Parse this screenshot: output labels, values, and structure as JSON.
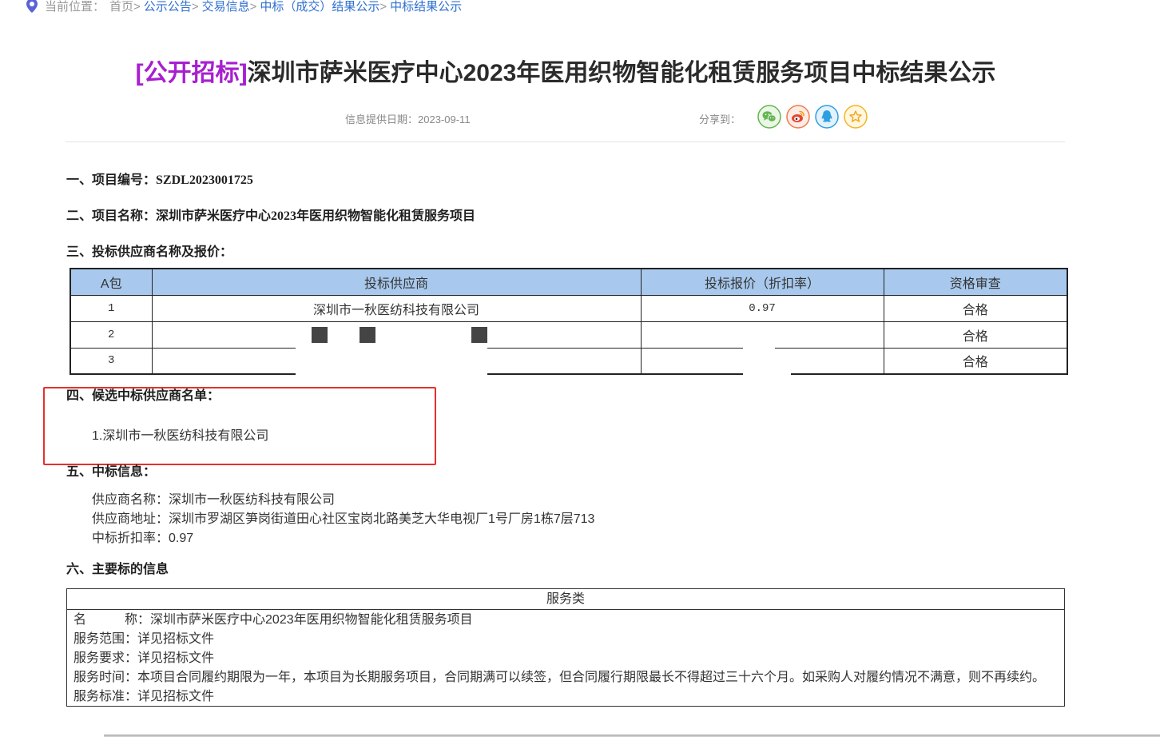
{
  "breadcrumb": {
    "prefix": "当前位置：",
    "separator": ">",
    "items": [
      {
        "label": "首页"
      },
      {
        "label": "公示公告"
      },
      {
        "label": "交易信息"
      },
      {
        "label": "中标（成交）结果公示"
      },
      {
        "label": "中标结果公示"
      }
    ]
  },
  "title": {
    "tag": "[公开招标]",
    "text": "深圳市萨米医疗中心2023年医用织物智能化租赁服务项目中标结果公示"
  },
  "meta": {
    "date_label": "信息提供日期：",
    "date": "2023-09-11",
    "share_label": "分享到：",
    "share_icons": [
      "wechat-icon",
      "weibo-icon",
      "qq-icon",
      "favorite-star-icon"
    ]
  },
  "section1": {
    "heading": "一、项目编号：",
    "value": "SZDL2023001725"
  },
  "section2": {
    "heading": "二、项目名称：",
    "value": "深圳市萨米医疗中心2023年医用织物智能化租赁服务项目"
  },
  "section3": {
    "heading": "三、投标供应商名称及报价：",
    "table": {
      "headers": [
        "A包",
        "投标供应商",
        "投标报价（折扣率）",
        "资格审查"
      ],
      "rows": [
        [
          "1",
          "深圳市一秋医纺科技有限公司",
          "0.97",
          "合格"
        ],
        [
          "2",
          "",
          "",
          "合格"
        ],
        [
          "3",
          "",
          "",
          "合格"
        ]
      ]
    }
  },
  "section4": {
    "heading": "四、候选中标供应商名单：",
    "candidates": [
      "1.深圳市一秋医纺科技有限公司"
    ]
  },
  "section5": {
    "heading": "五、中标信息：",
    "fields": [
      {
        "label": "供应商名称：",
        "value": "深圳市一秋医纺科技有限公司"
      },
      {
        "label": "供应商地址：",
        "value": "深圳市罗湖区笋岗街道田心社区宝岗北路美芝大华电视厂1号厂房1栋7层713"
      },
      {
        "label": "中标折扣率：",
        "value": "0.97"
      }
    ]
  },
  "section6": {
    "heading": "六、主要标的信息",
    "table": {
      "header": "服务类",
      "fields": [
        {
          "label": "名　　　称：",
          "value": "深圳市萨米医疗中心2023年医用织物智能化租赁服务项目"
        },
        {
          "label": "服务范围：",
          "value": "详见招标文件"
        },
        {
          "label": "服务要求：",
          "value": "详见招标文件"
        },
        {
          "label": "服务时间：",
          "value": "本项目合同履约期限为一年，本项目为长期服务项目，合同期满可以续签，但合同履行期限最长不得超过三十六个月。如采购人对履约情况不满意，则不再续约。"
        },
        {
          "label": "服务标准：",
          "value": "详见招标文件"
        }
      ]
    }
  },
  "colors": {
    "link": "#2f6fd1",
    "title_tag": "#a81fd0",
    "table_header_bg": "#a8c9ed",
    "annotation": "#e6302b"
  }
}
